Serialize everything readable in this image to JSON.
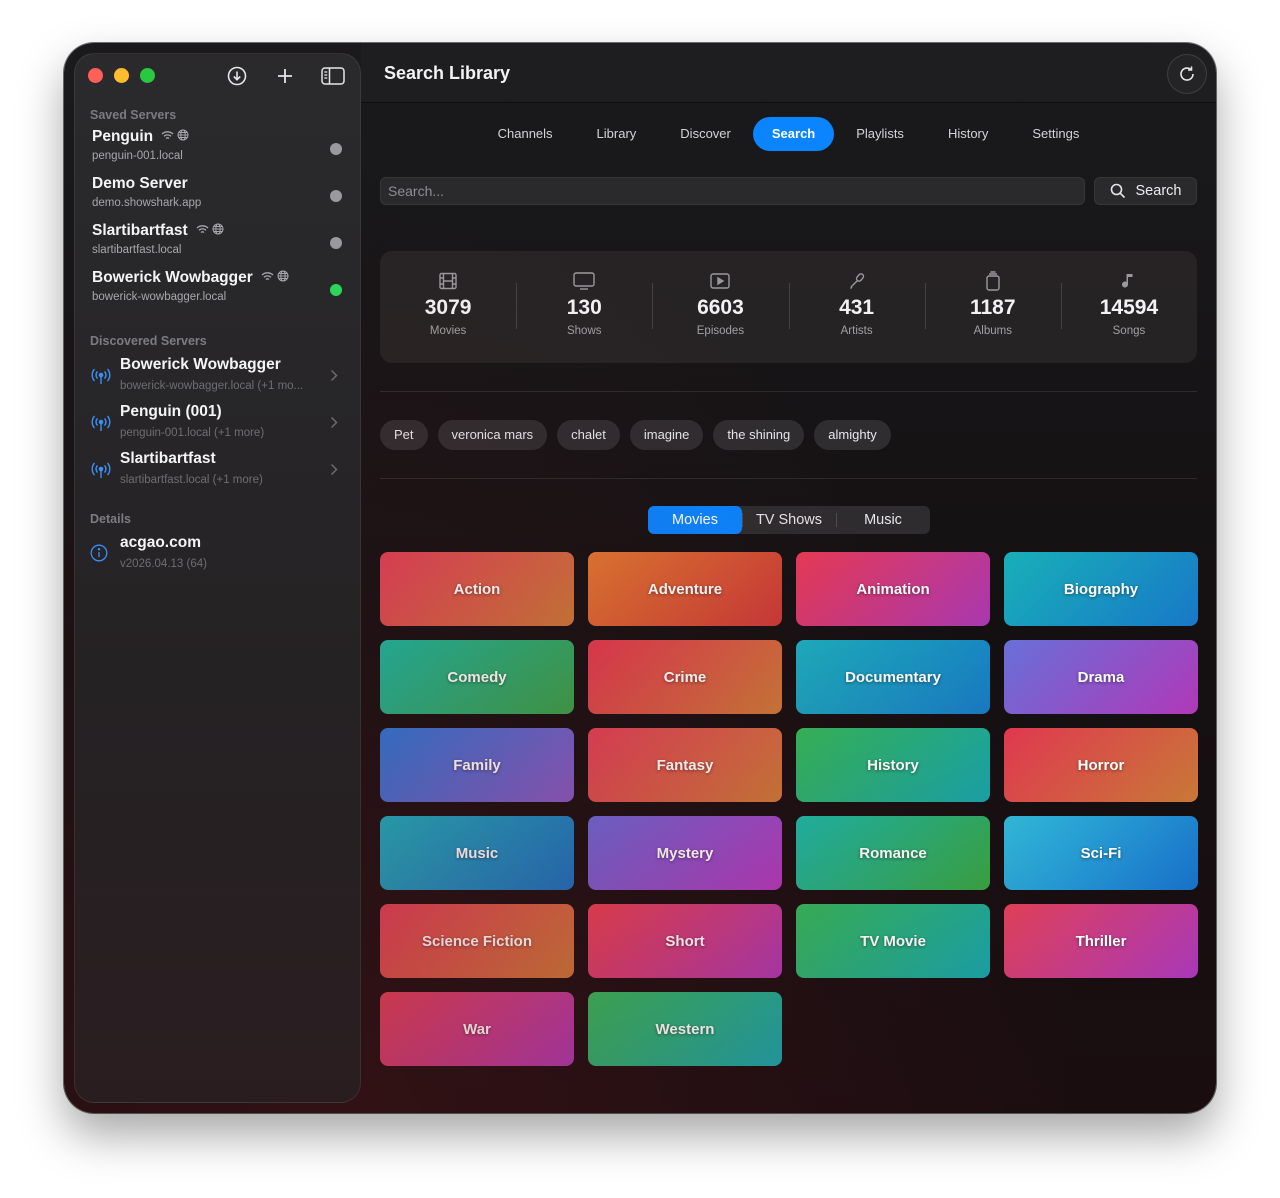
{
  "sidebar": {
    "saved_title": "Saved Servers",
    "saved": [
      {
        "name": "Penguin",
        "host": "penguin-001.local",
        "icons": [
          "wifi-icon",
          "globe-icon"
        ],
        "status": "offline"
      },
      {
        "name": "Demo Server",
        "host": "demo.showshark.app",
        "icons": [],
        "status": "offline"
      },
      {
        "name": "Slartibartfast",
        "host": "slartibartfast.local",
        "icons": [
          "wifi-icon",
          "globe-icon"
        ],
        "status": "offline"
      },
      {
        "name": "Bowerick Wowbagger",
        "host": "bowerick-wowbagger.local",
        "icons": [
          "wifi-icon",
          "globe-icon"
        ],
        "status": "online"
      }
    ],
    "discovered_title": "Discovered Servers",
    "discovered": [
      {
        "name": "Bowerick Wowbagger",
        "host": "bowerick-wowbagger.local (+1 mo..."
      },
      {
        "name": "Penguin (001)",
        "host": "penguin-001.local (+1 more)"
      },
      {
        "name": "Slartibartfast",
        "host": "slartibartfast.local (+1 more)"
      }
    ],
    "details_title": "Details",
    "details": {
      "name": "acgao.com",
      "version": "v2026.04.13 (64)"
    },
    "toolbar_icons": [
      "download-icon",
      "plus-icon",
      "sidebar-toggle-icon"
    ]
  },
  "header": {
    "title": "Search Library",
    "refresh_icon": "refresh-icon"
  },
  "tabs": [
    {
      "label": "Channels",
      "active": false
    },
    {
      "label": "Library",
      "active": false
    },
    {
      "label": "Discover",
      "active": false
    },
    {
      "label": "Search",
      "active": true
    },
    {
      "label": "Playlists",
      "active": false
    },
    {
      "label": "History",
      "active": false
    },
    {
      "label": "Settings",
      "active": false
    }
  ],
  "search": {
    "placeholder": "Search...",
    "value": "",
    "button_label": "Search"
  },
  "stats": [
    {
      "value": "3079",
      "label": "Movies",
      "icon": "film-icon"
    },
    {
      "value": "130",
      "label": "Shows",
      "icon": "tv-icon"
    },
    {
      "value": "6603",
      "label": "Episodes",
      "icon": "play-icon"
    },
    {
      "value": "431",
      "label": "Artists",
      "icon": "microphone-icon"
    },
    {
      "value": "1187",
      "label": "Albums",
      "icon": "album-icon"
    },
    {
      "value": "14594",
      "label": "Songs",
      "icon": "music-note-icon"
    }
  ],
  "recent_searches": [
    "Pet",
    "veronica mars",
    "chalet",
    "imagine",
    "the shining",
    "almighty"
  ],
  "segments": [
    {
      "label": "Movies",
      "active": true
    },
    {
      "label": "TV Shows",
      "active": false
    },
    {
      "label": "Music",
      "active": false
    }
  ],
  "genres": [
    {
      "label": "Action",
      "from": "#e04058",
      "to": "#c87838"
    },
    {
      "label": "Adventure",
      "from": "#e07830",
      "to": "#c83838"
    },
    {
      "label": "Animation",
      "from": "#e83a55",
      "to": "#a838b0"
    },
    {
      "label": "Biography",
      "from": "#18b0b8",
      "to": "#1878c8"
    },
    {
      "label": "Comedy",
      "from": "#18b8a0",
      "to": "#38a048"
    },
    {
      "label": "Crime",
      "from": "#e03850",
      "to": "#c87838"
    },
    {
      "label": "Documentary",
      "from": "#18b0c0",
      "to": "#1878c0"
    },
    {
      "label": "Drama",
      "from": "#6870d8",
      "to": "#b038b8"
    },
    {
      "label": "Family",
      "from": "#2878d8",
      "to": "#8858c0"
    },
    {
      "label": "Fantasy",
      "from": "#e04058",
      "to": "#c87838"
    },
    {
      "label": "History",
      "from": "#30b858",
      "to": "#18a0a8"
    },
    {
      "label": "Horror",
      "from": "#e03850",
      "to": "#c87838"
    },
    {
      "label": "Music",
      "from": "#18b0c0",
      "to": "#1870c0"
    },
    {
      "label": "Mystery",
      "from": "#6868d8",
      "to": "#b038b8"
    },
    {
      "label": "Romance",
      "from": "#18b8a8",
      "to": "#38a040"
    },
    {
      "label": "Sci-Fi",
      "from": "#30b8d8",
      "to": "#1870c8"
    },
    {
      "label": "Science Fiction",
      "from": "#e04058",
      "to": "#c87838"
    },
    {
      "label": "Short",
      "from": "#e84050",
      "to": "#a838b0"
    },
    {
      "label": "TV Movie",
      "from": "#30b858",
      "to": "#18a0a8"
    },
    {
      "label": "Thriller",
      "from": "#e04058",
      "to": "#a838b8"
    },
    {
      "label": "War",
      "from": "#e04058",
      "to": "#a838b0"
    },
    {
      "label": "Western",
      "from": "#30b858",
      "to": "#18a0a8"
    }
  ],
  "colors": {
    "accent": "#0a84ff",
    "online": "#2dd55b",
    "offline": "#9a9a9e"
  }
}
